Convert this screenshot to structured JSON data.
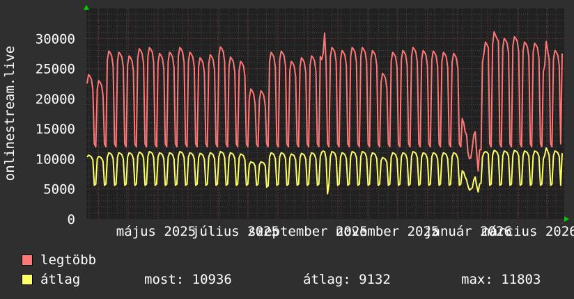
{
  "chart_data": {
    "type": "line",
    "ylabel": "onlinestream.live",
    "ylim": [
      0,
      35000
    ],
    "yticks": [
      "0",
      "5000",
      "10000",
      "15000",
      "20000",
      "25000",
      "30000"
    ],
    "xtick_labels": [
      "május 2025",
      "július 2025",
      "szeptember 2025",
      "november 2025",
      "január 2026",
      "március 2026"
    ],
    "grid": true,
    "colors": {
      "max": "#ff7777",
      "avg": "#ffff66",
      "background": "#2f2f2f",
      "plot": "#212121",
      "arrow": "#00cc00"
    },
    "series": [
      {
        "name": "legtöbb",
        "color": "#ff7777",
        "values": [
          22500,
          24000,
          23700,
          23200,
          21500,
          12500,
          12000,
          21500,
          23000,
          22700,
          22200,
          20500,
          12500,
          12000,
          26400,
          27900,
          27600,
          27100,
          25400,
          12500,
          12000,
          26200,
          27700,
          27400,
          26900,
          25200,
          12500,
          12000,
          25600,
          27100,
          26800,
          26300,
          24600,
          12500,
          12000,
          26800,
          28300,
          28000,
          27500,
          25800,
          12500,
          12000,
          27000,
          28500,
          28200,
          27700,
          26000,
          12500,
          12000,
          26000,
          27500,
          27200,
          26700,
          25000,
          12500,
          12000,
          26200,
          27700,
          27400,
          26900,
          25200,
          12500,
          12000,
          27000,
          28500,
          28200,
          27700,
          26000,
          12500,
          12000,
          26200,
          27700,
          27400,
          26900,
          25200,
          12500,
          12000,
          25300,
          26800,
          26500,
          26000,
          24300,
          12500,
          12000,
          25800,
          27300,
          27000,
          26500,
          24800,
          12500,
          12000,
          27100,
          28600,
          28300,
          27800,
          26100,
          12500,
          12000,
          25400,
          26900,
          26600,
          26100,
          24400,
          12500,
          12000,
          24700,
          26200,
          25900,
          25400,
          23700,
          12500,
          12000,
          20100,
          21600,
          21300,
          20800,
          19100,
          12500,
          12000,
          19800,
          21300,
          21000,
          20500,
          18800,
          12500,
          12000,
          26200,
          27700,
          27400,
          26900,
          25200,
          12500,
          12000,
          26400,
          27900,
          27600,
          27100,
          25400,
          12500,
          12000,
          24700,
          26200,
          25900,
          25400,
          23700,
          12500,
          12000,
          25300,
          26800,
          26500,
          26000,
          24300,
          12500,
          12000,
          25600,
          27100,
          26800,
          26300,
          24600,
          12500,
          12000,
          27000,
          26500,
          27500,
          30900,
          26000,
          12500,
          12000,
          27000,
          28500,
          28200,
          27700,
          26000,
          12500,
          12000,
          26500,
          28000,
          27700,
          27200,
          25500,
          12500,
          12000,
          27000,
          28500,
          28200,
          27700,
          26000,
          12500,
          12000,
          27000,
          28500,
          28200,
          27700,
          26000,
          12500,
          12000,
          26500,
          28000,
          27700,
          27200,
          25500,
          12500,
          12000,
          22700,
          24200,
          23900,
          23400,
          21700,
          12500,
          12000,
          26200,
          27700,
          27400,
          26900,
          25200,
          12500,
          12000,
          26500,
          28000,
          27700,
          27200,
          25500,
          12500,
          12000,
          27000,
          28500,
          28200,
          27700,
          26000,
          12500,
          12000,
          26500,
          28000,
          27700,
          27200,
          25500,
          12500,
          12000,
          26400,
          27900,
          27600,
          27100,
          25400,
          12500,
          12000,
          26200,
          27700,
          27400,
          26900,
          25200,
          12500,
          12000,
          26000,
          27500,
          27200,
          26700,
          25000,
          12500,
          12000,
          16700,
          16000,
          14500,
          14000,
          11000,
          10000,
          10200,
          12000,
          14000,
          14500,
          11000,
          8000,
          11500,
          11500,
          26000,
          27500,
          29400,
          29000,
          28500,
          12500,
          12000,
          29000,
          31100,
          30500,
          30000,
          29500,
          12500,
          12000,
          28500,
          30000,
          29700,
          29200,
          27500,
          12500,
          12000,
          28800,
          30300,
          30000,
          29500,
          27800,
          12500,
          12000,
          27900,
          29400,
          29100,
          28600,
          26900,
          12500,
          12000,
          27700,
          29200,
          28900,
          28400,
          26700,
          12500,
          12000,
          24500,
          25500,
          29500,
          28000,
          26500,
          12500,
          12000,
          26500,
          28000,
          27700,
          27200,
          25500,
          12500,
          27500
        ]
      },
      {
        "name": "átlag",
        "color": "#ffff66",
        "values": [
          10300,
          10600,
          10500,
          10300,
          9800,
          5600,
          5800,
          10000,
          10400,
          10300,
          10100,
          9600,
          5600,
          5800,
          10300,
          11000,
          10900,
          10700,
          10000,
          5600,
          5800,
          10300,
          11000,
          10900,
          10700,
          10000,
          5600,
          5800,
          10300,
          11000,
          10900,
          10700,
          10000,
          5600,
          5800,
          10400,
          11100,
          11000,
          10800,
          10100,
          5600,
          5800,
          10400,
          11200,
          11100,
          10900,
          10200,
          5600,
          5800,
          10300,
          11000,
          10900,
          10700,
          10000,
          5600,
          5800,
          10300,
          11000,
          10900,
          10700,
          10000,
          5600,
          5800,
          10400,
          11200,
          11100,
          10900,
          10200,
          5600,
          5800,
          10300,
          11000,
          10900,
          10700,
          10000,
          5600,
          5800,
          10200,
          10900,
          10800,
          10600,
          9900,
          5600,
          5800,
          10300,
          11000,
          10900,
          10700,
          10000,
          5600,
          5800,
          10400,
          11200,
          11100,
          10900,
          10200,
          5600,
          5800,
          10300,
          11000,
          10900,
          10700,
          10000,
          5600,
          5800,
          10200,
          10800,
          10700,
          10500,
          9800,
          5600,
          5800,
          9000,
          9500,
          9400,
          9300,
          8800,
          5600,
          5800,
          9000,
          9500,
          9400,
          9300,
          8800,
          5300,
          5500,
          10300,
          11000,
          10900,
          10700,
          10000,
          5600,
          5800,
          10300,
          11000,
          10900,
          10700,
          10000,
          5600,
          5800,
          10200,
          10800,
          10700,
          10500,
          9800,
          5600,
          5800,
          10200,
          10900,
          10800,
          10600,
          9900,
          5600,
          5800,
          10300,
          11000,
          10900,
          10700,
          10000,
          5600,
          5800,
          10400,
          11100,
          11300,
          11200,
          10000,
          4200,
          5800,
          10400,
          11200,
          11100,
          10900,
          10200,
          5600,
          5800,
          10300,
          11000,
          10900,
          10700,
          10000,
          5600,
          5800,
          10400,
          11200,
          11100,
          10900,
          10200,
          5600,
          5800,
          10400,
          11200,
          11100,
          10900,
          10200,
          5600,
          5800,
          10300,
          11000,
          10900,
          10700,
          10000,
          5600,
          5800,
          9700,
          10200,
          10100,
          9900,
          9400,
          5600,
          5800,
          10300,
          11000,
          10900,
          10700,
          10000,
          5600,
          5800,
          10300,
          11000,
          10900,
          10700,
          10000,
          5600,
          5800,
          10400,
          11200,
          11100,
          10900,
          10200,
          5600,
          5800,
          10300,
          11000,
          10900,
          10700,
          10000,
          5600,
          5800,
          10300,
          11000,
          10900,
          10700,
          10000,
          5600,
          5800,
          10300,
          11000,
          10900,
          10700,
          10000,
          5600,
          5800,
          10300,
          11000,
          10900,
          10700,
          10000,
          5600,
          5800,
          8000,
          7800,
          7000,
          6500,
          5500,
          4800,
          5000,
          5200,
          6500,
          7000,
          5500,
          4500,
          5800,
          6000,
          10300,
          11000,
          11200,
          11100,
          10800,
          5600,
          5800,
          10600,
          11400,
          11300,
          11100,
          10500,
          5600,
          5800,
          10500,
          11300,
          11200,
          11000,
          10400,
          5600,
          5800,
          10600,
          11400,
          11300,
          11100,
          10500,
          5600,
          5800,
          10500,
          11300,
          11200,
          11000,
          10400,
          5600,
          5800,
          10500,
          11300,
          11200,
          11000,
          10400,
          5600,
          5800,
          10000,
          10600,
          11800,
          11300,
          10600,
          5600,
          5800,
          10500,
          11300,
          11200,
          11000,
          10400,
          5600,
          10936
        ]
      }
    ]
  },
  "legend": {
    "max_label": "legtöbb",
    "avg_label": "átlag",
    "current": "most: 10936",
    "average": "átlag: 9132",
    "maximum": "max: 11803"
  }
}
